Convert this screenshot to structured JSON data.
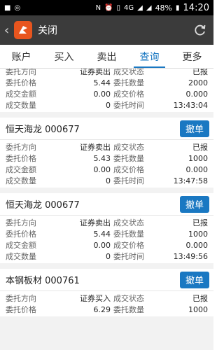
{
  "status_bar": {
    "battery": "48%",
    "time": "14:20",
    "network": "4G"
  },
  "header": {
    "title": "关闭"
  },
  "tabs": [
    {
      "label": "账户"
    },
    {
      "label": "买入"
    },
    {
      "label": "卖出"
    },
    {
      "label": "查询"
    },
    {
      "label": "更多"
    }
  ],
  "labels": {
    "direction": "委托方向",
    "price": "委托价格",
    "amount": "成交金额",
    "qty": "成交数量",
    "status": "成交状态",
    "order_qty": "委托数量",
    "deal_price": "成交价格",
    "order_time": "委托时间",
    "cancel": "撤单"
  },
  "orders": [
    {
      "stock": "",
      "direction": "证券卖出",
      "price": "5.44",
      "amount": "0.00",
      "qty": "0",
      "status": "已报",
      "order_qty": "2000",
      "deal_price": "0.000",
      "order_time": "13:43:04"
    },
    {
      "stock": "恒天海龙 000677",
      "direction": "证券卖出",
      "price": "5.43",
      "amount": "0.00",
      "qty": "0",
      "status": "已报",
      "order_qty": "1000",
      "deal_price": "0.000",
      "order_time": "13:47:58"
    },
    {
      "stock": "恒天海龙 000677",
      "direction": "证券卖出",
      "price": "5.44",
      "amount": "0.00",
      "qty": "0",
      "status": "已报",
      "order_qty": "1000",
      "deal_price": "0.000",
      "order_time": "13:49:56"
    },
    {
      "stock": "本钢板材 000761",
      "direction": "证券买入",
      "price": "6.29",
      "amount": "",
      "qty": "",
      "status": "已报",
      "order_qty": "1000",
      "deal_price": "",
      "order_time": ""
    }
  ],
  "colors": {
    "accent": "#1a78c2",
    "title_bar": "#3b3b3b",
    "logo": "#e8551e"
  }
}
